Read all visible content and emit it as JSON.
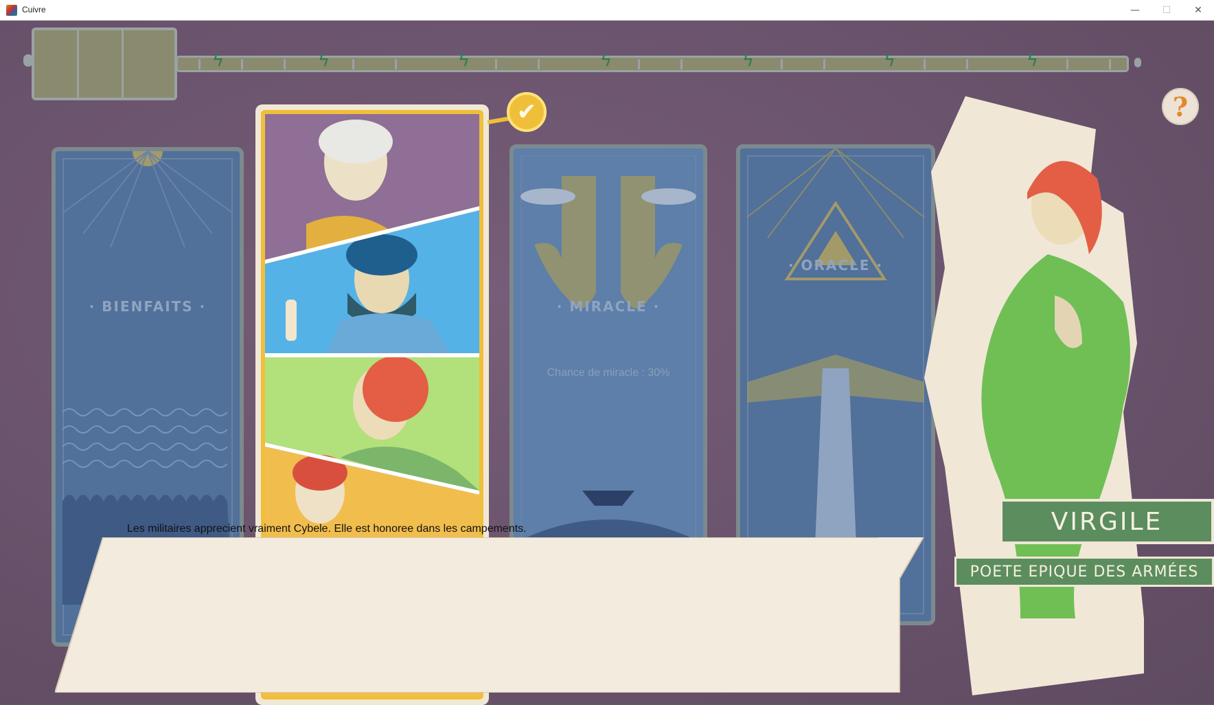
{
  "window": {
    "title": "Cuivre",
    "minimize_symbol": "—",
    "maximize_symbol": "☐",
    "close_symbol": "✕"
  },
  "timeline": {
    "bolt_symbol": "ϟ",
    "milestones": 7
  },
  "help": {
    "label": "?"
  },
  "cards": {
    "bienfaits": {
      "title": "· BIENFAITS ·"
    },
    "miracle": {
      "title": "· MIRACLE ·",
      "chance": "Chance de miracle : 30%"
    },
    "oracle": {
      "title": "· ORACLE ·"
    },
    "selected": {
      "check_symbol": "✔"
    }
  },
  "dialog": {
    "text": "Les militaires apprecient vraiment Cybele. Elle est honoree dans les campements."
  },
  "character": {
    "name": "VIRGILE",
    "role": "POETE EPIQUE DES ARMÉES"
  },
  "colors": {
    "background": "#6b546d",
    "card_blue": "#51709a",
    "selected_frame": "#f0bf3a",
    "plate_green": "#5c8d5e",
    "parchment": "#f1e7d6"
  }
}
